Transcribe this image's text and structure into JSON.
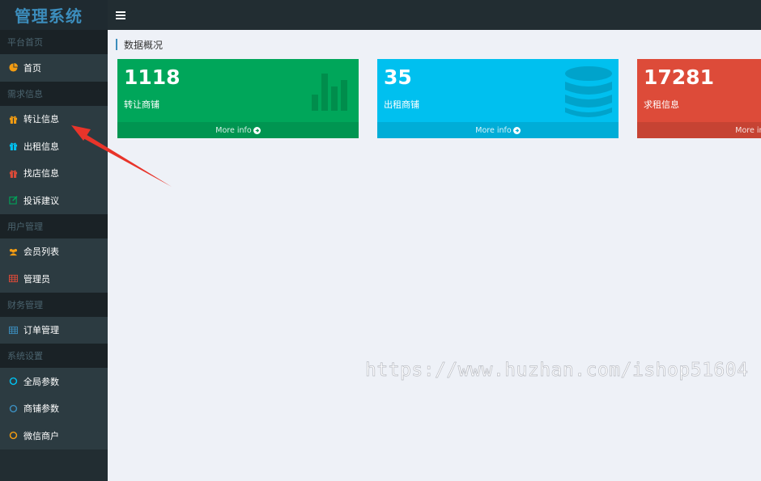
{
  "app": {
    "title": "管理系统"
  },
  "sidebar": {
    "sections": [
      {
        "header": "平台首页",
        "items": [
          {
            "label": "首页",
            "icon": "pie-chart-icon",
            "color": "#f39c12"
          }
        ]
      },
      {
        "header": "需求信息",
        "items": [
          {
            "label": "转让信息",
            "icon": "gift-icon",
            "color": "#f39c12"
          },
          {
            "label": "出租信息",
            "icon": "gift-icon",
            "color": "#00c0ef"
          },
          {
            "label": "找店信息",
            "icon": "gift-icon",
            "color": "#dd4b39"
          },
          {
            "label": "投诉建议",
            "icon": "edit-icon",
            "color": "#00a65a"
          }
        ]
      },
      {
        "header": "用户管理",
        "items": [
          {
            "label": "会员列表",
            "icon": "users-icon",
            "color": "#f39c12"
          },
          {
            "label": "管理员",
            "icon": "table-icon",
            "color": "#dd4b39"
          }
        ]
      },
      {
        "header": "财务管理",
        "items": [
          {
            "label": "订单管理",
            "icon": "table-icon",
            "color": "#3c8dbc"
          }
        ]
      },
      {
        "header": "系统设置",
        "items": [
          {
            "label": "全局参数",
            "icon": "circle-icon",
            "color": "#00c0ef"
          },
          {
            "label": "商铺参数",
            "icon": "circle-icon",
            "color": "#3c8dbc"
          },
          {
            "label": "微信商户",
            "icon": "circle-icon",
            "color": "#f39c12"
          }
        ]
      }
    ]
  },
  "content": {
    "title": "数据概况",
    "boxes": [
      {
        "number": "1118",
        "label": "转让商铺",
        "footer": "More info",
        "icon": "bar-chart-icon",
        "color": "#00a65a"
      },
      {
        "number": "35",
        "label": "出租商铺",
        "footer": "More info",
        "icon": "database-icon",
        "color": "#00c0ef"
      },
      {
        "number": "17281",
        "label": "求租信息",
        "footer": "More info",
        "icon": "",
        "color": "#dd4b39"
      }
    ]
  },
  "watermark": "https://www.huzhan.com/ishop51604"
}
